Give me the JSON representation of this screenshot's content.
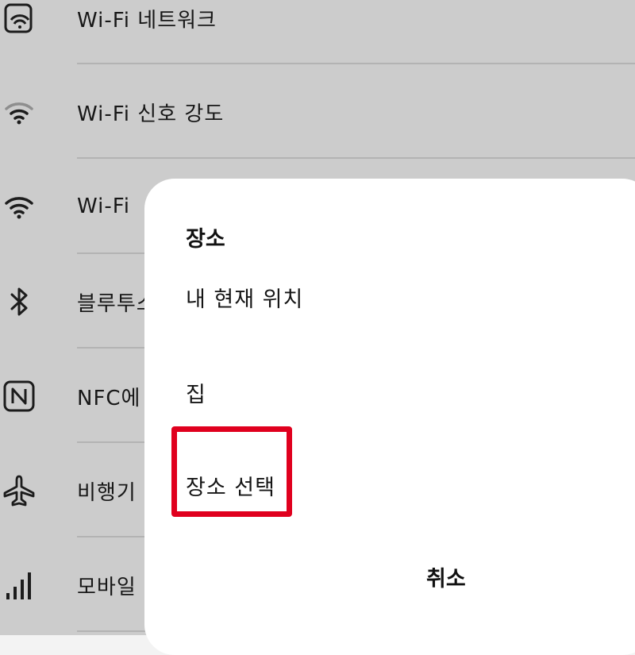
{
  "settings_list": {
    "items": [
      {
        "label": "Wi-Fi 네트워크",
        "icon": "wifi-network-icon"
      },
      {
        "label": "Wi-Fi 신호 강도",
        "icon": "wifi-signal-icon"
      },
      {
        "label": "Wi-Fi",
        "icon": "wifi-icon"
      },
      {
        "label": "블루투스",
        "icon": "bluetooth-icon"
      },
      {
        "label": "NFC에",
        "icon": "nfc-icon"
      },
      {
        "label": "비행기",
        "icon": "airplane-icon"
      },
      {
        "label": "모바일 ı",
        "icon": "mobile-signal-icon"
      }
    ]
  },
  "dialog": {
    "title": "장소",
    "options": [
      {
        "label": "내 현재 위치"
      },
      {
        "label": "집"
      },
      {
        "label": "장소 선택",
        "highlighted": true
      }
    ],
    "cancel_label": "취소"
  },
  "colors": {
    "highlight_border": "#e0001e",
    "background": "#f3f3f3",
    "sheet": "#ffffff"
  }
}
